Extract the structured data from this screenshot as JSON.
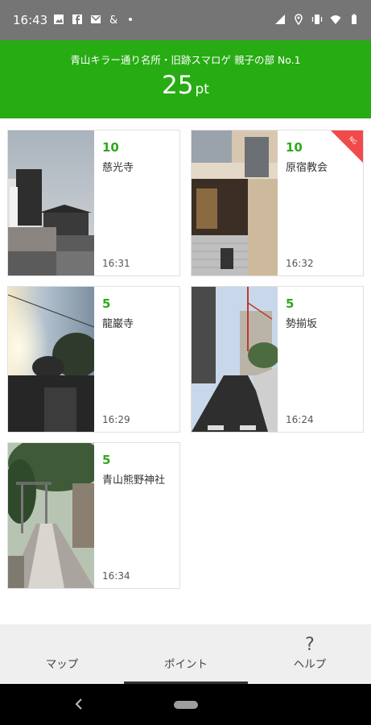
{
  "status_bar": {
    "time": "16:43",
    "left_icons": [
      "image-icon",
      "facebook-icon",
      "gmail-icon",
      "ampersand-icon",
      "dot-icon"
    ],
    "right_icons": [
      "wifi-calling-icon",
      "location-icon",
      "vibrate-icon",
      "wifi-icon",
      "battery-icon"
    ]
  },
  "header": {
    "title": "青山キラー通り名所・旧跡スマロゲ 親子の部 No.1",
    "points_value": "25",
    "points_unit": "pt",
    "background_color": "#27ac13"
  },
  "checkpoints": [
    {
      "points": "10",
      "name": "慈光寺",
      "time": "16:31",
      "badge": ""
    },
    {
      "points": "10",
      "name": "原宿教会",
      "time": "16:32",
      "badge": "NG"
    },
    {
      "points": "5",
      "name": "龍巌寺",
      "time": "16:29",
      "badge": ""
    },
    {
      "points": "5",
      "name": "勢揃坂",
      "time": "16:24",
      "badge": ""
    },
    {
      "points": "5",
      "name": "青山熊野神社",
      "time": "16:34",
      "badge": ""
    }
  ],
  "bottom_nav": {
    "items": [
      {
        "label": "マップ",
        "icon": ""
      },
      {
        "label": "ポイント",
        "icon": ""
      },
      {
        "label": "ヘルプ",
        "icon": "?"
      }
    ],
    "active_index": 1
  },
  "colors": {
    "points_green": "#2ea91a",
    "ribbon_red": "#f04a4a"
  }
}
